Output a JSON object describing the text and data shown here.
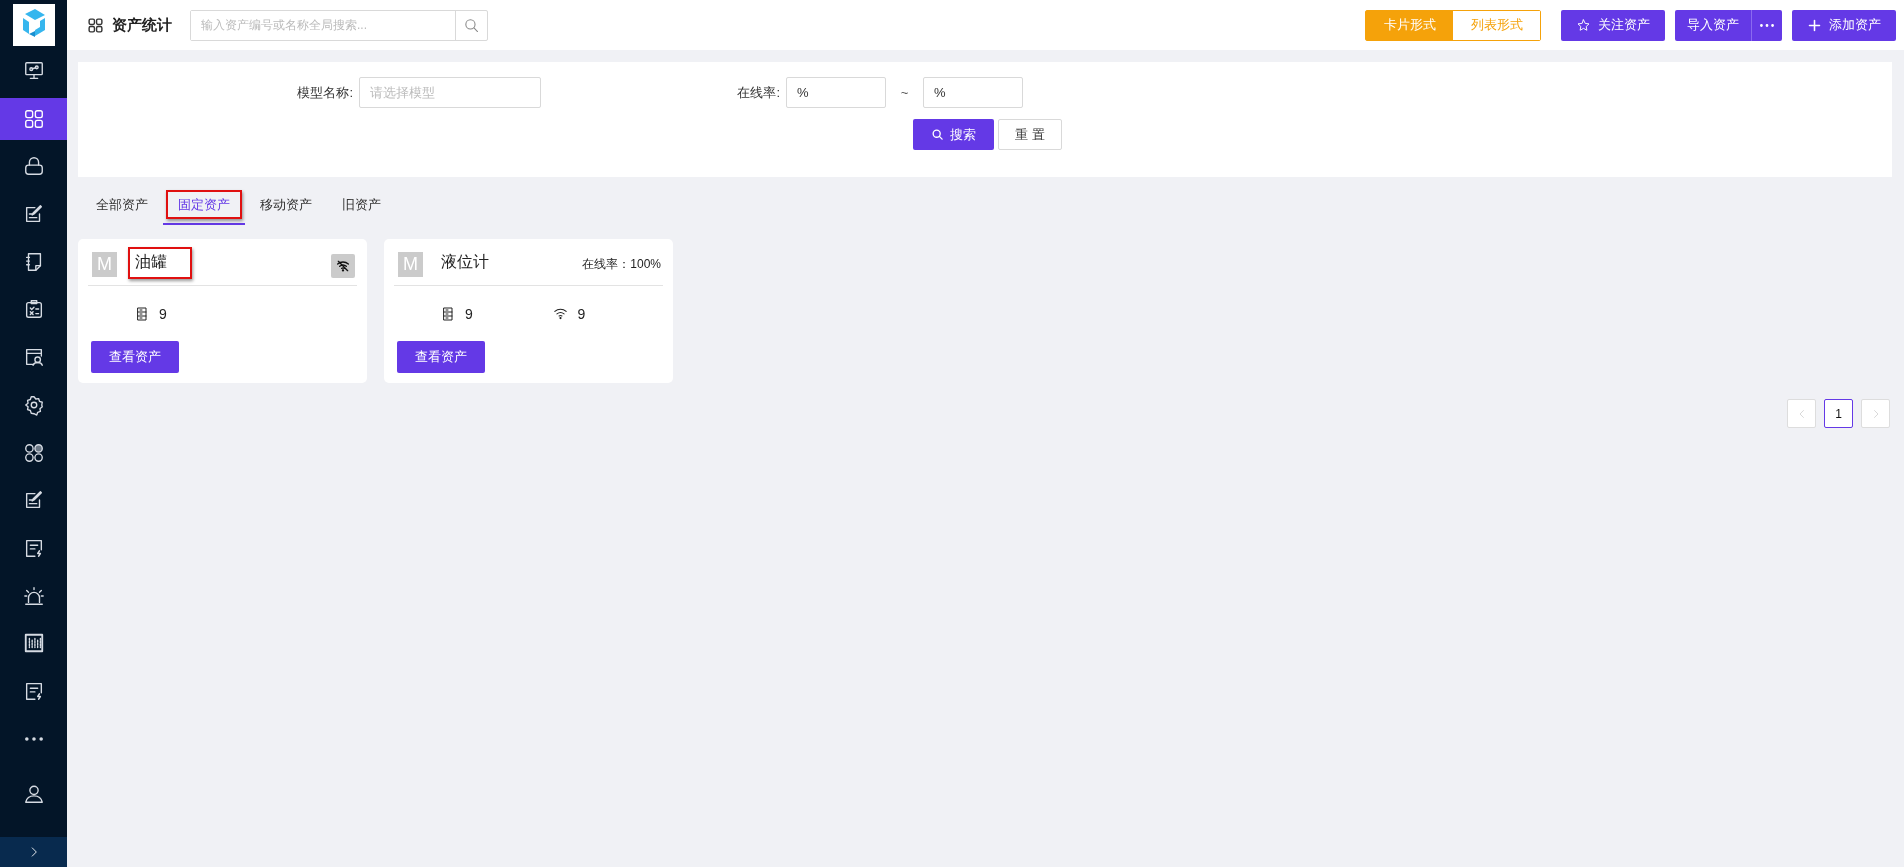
{
  "sidebar": {
    "items": [
      {
        "selected": false
      },
      {
        "selected": true
      },
      {
        "selected": false
      },
      {
        "selected": false
      },
      {
        "selected": false
      },
      {
        "selected": false
      },
      {
        "selected": false
      },
      {
        "selected": false
      },
      {
        "selected": false
      },
      {
        "selected": false
      },
      {
        "selected": false
      },
      {
        "selected": false
      },
      {
        "selected": false
      },
      {
        "selected": false
      },
      {
        "selected": false
      },
      {
        "selected": false
      }
    ]
  },
  "header": {
    "title": "资产统计",
    "search": {
      "placeholder": "输入资产编号或名称全局搜索..."
    },
    "view_toggle": [
      {
        "label": "卡片形式",
        "selected": true
      },
      {
        "label": "列表形式",
        "selected": false
      }
    ],
    "actions": [
      {
        "kind": "star",
        "label": "关注资产"
      },
      {
        "kind": "split",
        "label": "导入资产"
      },
      {
        "kind": "plus",
        "label": "添加资产"
      }
    ]
  },
  "filter": {
    "model_label": "模型名称:",
    "model_placeholder": "请选择模型",
    "rate_label": "在线率:",
    "rate_min": "%",
    "separator": "~",
    "rate_max": "%",
    "search_button": "搜索",
    "reset_button": "重 置"
  },
  "tabs": [
    {
      "label": "全部资产",
      "selected": false,
      "highlighted": false
    },
    {
      "label": "固定资产",
      "selected": true,
      "highlighted": true
    },
    {
      "label": "移动资产",
      "selected": false,
      "highlighted": false
    },
    {
      "label": "旧资产",
      "selected": false,
      "highlighted": false
    }
  ],
  "cards": [
    {
      "avatar": "M",
      "title": "油罐",
      "highlighted": true,
      "offline": true,
      "stats": [
        {
          "kind": "device",
          "value": "9"
        }
      ],
      "button": "查看资产"
    },
    {
      "avatar": "M",
      "title": "液位计",
      "highlighted": false,
      "offline": false,
      "online_rate": "在线率：100%",
      "stats": [
        {
          "kind": "device",
          "value": "9"
        },
        {
          "kind": "wifi",
          "value": "9"
        }
      ],
      "button": "查看资产"
    }
  ],
  "pagination": {
    "pages": [
      {
        "label": "1",
        "selected": true
      }
    ]
  }
}
